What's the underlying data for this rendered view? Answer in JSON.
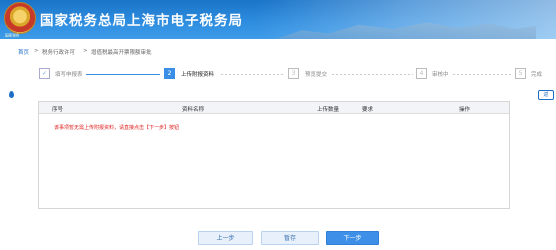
{
  "header": {
    "title": "国家税务总局上海市电子税务局",
    "emblem_text": "国家税务"
  },
  "breadcrumb": {
    "items": [
      "首页",
      "税务行政许可",
      "增值税最高开票限额审批"
    ],
    "separator": ">",
    "back_label": "返"
  },
  "steps": [
    {
      "number": "✓",
      "label": "填写申报表",
      "state": "done"
    },
    {
      "number": "2",
      "label": "上传附报资料",
      "state": "active"
    },
    {
      "number": "3",
      "label": "预览提交",
      "state": "pending"
    },
    {
      "number": "4",
      "label": "审核中",
      "state": "pending"
    },
    {
      "number": "5",
      "label": "完成",
      "state": "pending"
    }
  ],
  "table": {
    "columns": [
      "序号",
      "资料名称",
      "上传数量",
      "要求",
      "操作"
    ],
    "notice": "该事项暂无需上传附报资料，请直接点击【下一步】按钮"
  },
  "actions": {
    "prev_label": "上一步",
    "save_label": "暂存",
    "next_label": "下一步"
  },
  "colors": {
    "brand_blue": "#2f8ee0",
    "active_step": "#3a8ee6",
    "notice_red": "#e02020"
  }
}
